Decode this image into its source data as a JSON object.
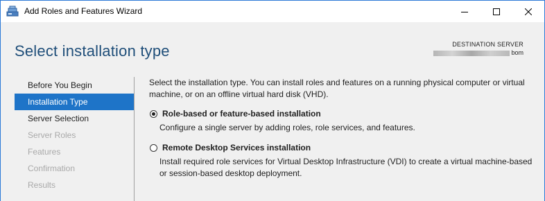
{
  "window": {
    "title": "Add Roles and Features Wizard",
    "accent_color": "#1e74c8",
    "title_color": "#1f4e79"
  },
  "header": {
    "page_title": "Select installation type",
    "destination_label": "DESTINATION SERVER",
    "destination_value": "bom"
  },
  "nav": {
    "items": [
      {
        "label": "Before You Begin",
        "state": "enabled"
      },
      {
        "label": "Installation Type",
        "state": "active"
      },
      {
        "label": "Server Selection",
        "state": "enabled"
      },
      {
        "label": "Server Roles",
        "state": "disabled"
      },
      {
        "label": "Features",
        "state": "disabled"
      },
      {
        "label": "Confirmation",
        "state": "disabled"
      },
      {
        "label": "Results",
        "state": "disabled"
      }
    ]
  },
  "content": {
    "intro": "Select the installation type. You can install roles and features on a running physical computer or virtual machine, or on an offline virtual hard disk (VHD).",
    "options": [
      {
        "title": "Role-based or feature-based installation",
        "description": "Configure a single server by adding roles, role services, and features.",
        "selected": true
      },
      {
        "title": "Remote Desktop Services installation",
        "description": "Install required role services for Virtual Desktop Infrastructure (VDI) to create a virtual machine-based or session-based desktop deployment.",
        "selected": false
      }
    ]
  }
}
